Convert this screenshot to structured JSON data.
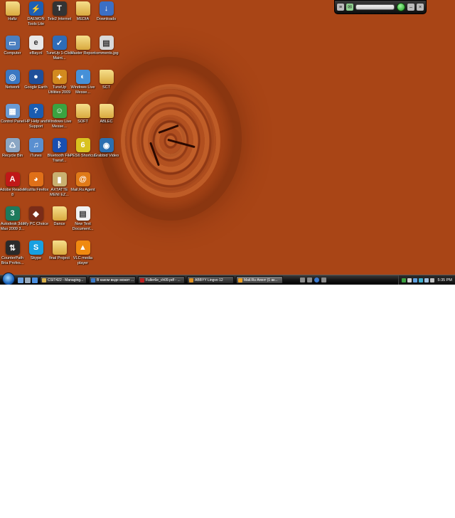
{
  "desktop": {
    "icons": [
      {
        "label": "Hafiz",
        "glyph": "",
        "color": "folder"
      },
      {
        "label": "DAEMON Tools Lite",
        "glyph": "⚡",
        "color": "#1d5fb4"
      },
      {
        "label": "Tele2 Internet",
        "glyph": "T",
        "color": "#333333"
      },
      {
        "label": "MEDIA",
        "glyph": "",
        "color": "folder"
      },
      {
        "label": "Downloads",
        "glyph": "↓",
        "color": "#3c6fc4"
      },
      {
        "label": "Computer",
        "glyph": "▭",
        "color": "#4b7fc0"
      },
      {
        "label": "eBay.nl",
        "glyph": "e",
        "color": "#e8e8e8"
      },
      {
        "label": "TuneUp 1-Click Maint...",
        "glyph": "✓",
        "color": "#2e6cb8"
      },
      {
        "label": "Master Report",
        "glyph": "",
        "color": "folder"
      },
      {
        "label": "comments.jpg",
        "glyph": "▤",
        "color": "#d8d8d8"
      },
      {
        "label": "Network",
        "glyph": "◎",
        "color": "#3a77c2"
      },
      {
        "label": "Google Earth",
        "glyph": "●",
        "color": "#1f4f9a"
      },
      {
        "label": "TuneUp Utilities 2009",
        "glyph": "✦",
        "color": "#d28a1f"
      },
      {
        "label": "Windows Live Messe...",
        "glyph": "◐",
        "color": "#4690d8"
      },
      {
        "label": "SCT",
        "glyph": "",
        "color": "folder"
      },
      {
        "label": "Control Panel",
        "glyph": "▦",
        "color": "#6a9bd4"
      },
      {
        "label": "HP Help and Support",
        "glyph": "?",
        "color": "#1b5cb0"
      },
      {
        "label": "Windows Live Messe...",
        "glyph": "☺",
        "color": "#3aa340"
      },
      {
        "label": "SOFT",
        "glyph": "",
        "color": "folder"
      },
      {
        "label": "ABLEC",
        "glyph": "",
        "color": "folder"
      },
      {
        "label": "Recycle Bin",
        "glyph": "♺",
        "color": "#8aa6c4"
      },
      {
        "label": "iTunes",
        "glyph": "♫",
        "color": "#5a8fd0"
      },
      {
        "label": "Bluetooth File Transf...",
        "glyph": "ᛒ",
        "color": "#1a4fb0"
      },
      {
        "label": "PES6 Shortcut",
        "glyph": "6",
        "color": "#d9c21f"
      },
      {
        "label": "Grabbid Video",
        "glyph": "◉",
        "color": "#2c6fb0"
      },
      {
        "label": "Adobe Reader 8",
        "glyph": "A",
        "color": "#c01818"
      },
      {
        "label": "Mozilla Firefox",
        "glyph": "◕",
        "color": "#e07018"
      },
      {
        "label": "AXTATTE MENI EZ...",
        "glyph": "▮",
        "color": "#c9b070"
      },
      {
        "label": "Mail.Ru Agent",
        "glyph": "@",
        "color": "#e07a18"
      },
      {
        "label": "Autodesk 3ds Max 2009 3...",
        "glyph": "3",
        "color": "#1e7a5c"
      },
      {
        "label": "My PC Choice",
        "glyph": "◆",
        "color": "#7a2c18"
      },
      {
        "label": "Dance",
        "glyph": "",
        "color": "folder"
      },
      {
        "label": "New Text Document...",
        "glyph": "▤",
        "color": "#f0f0f0"
      },
      {
        "label": "CounterPath Bria Profes...",
        "glyph": "⇅",
        "color": "#2a2a2a"
      },
      {
        "label": "Skype",
        "glyph": "S",
        "color": "#18a0e0"
      },
      {
        "label": "final Project",
        "glyph": "",
        "color": "folder"
      },
      {
        "label": "VLC media player",
        "glyph": "▲",
        "color": "#f08a10"
      }
    ]
  },
  "gadget": {
    "go_label": ""
  },
  "taskbar": {
    "tasks": [
      {
        "label": "CSIT422 - Managing...",
        "color": "#d9b04a"
      },
      {
        "label": "В каком виде может ...",
        "color": "#3c7ac8"
      },
      {
        "label": "Fuller6e_ch09.pdf - ...",
        "color": "#c02020"
      },
      {
        "label": "ABBYY Lingvo 12",
        "color": "#e09020"
      },
      {
        "label": "Mail.Ru Агент (1 ак...",
        "color": "#f0a020"
      }
    ],
    "clock": "5:35 PM",
    "accent": "#1b63b8"
  }
}
